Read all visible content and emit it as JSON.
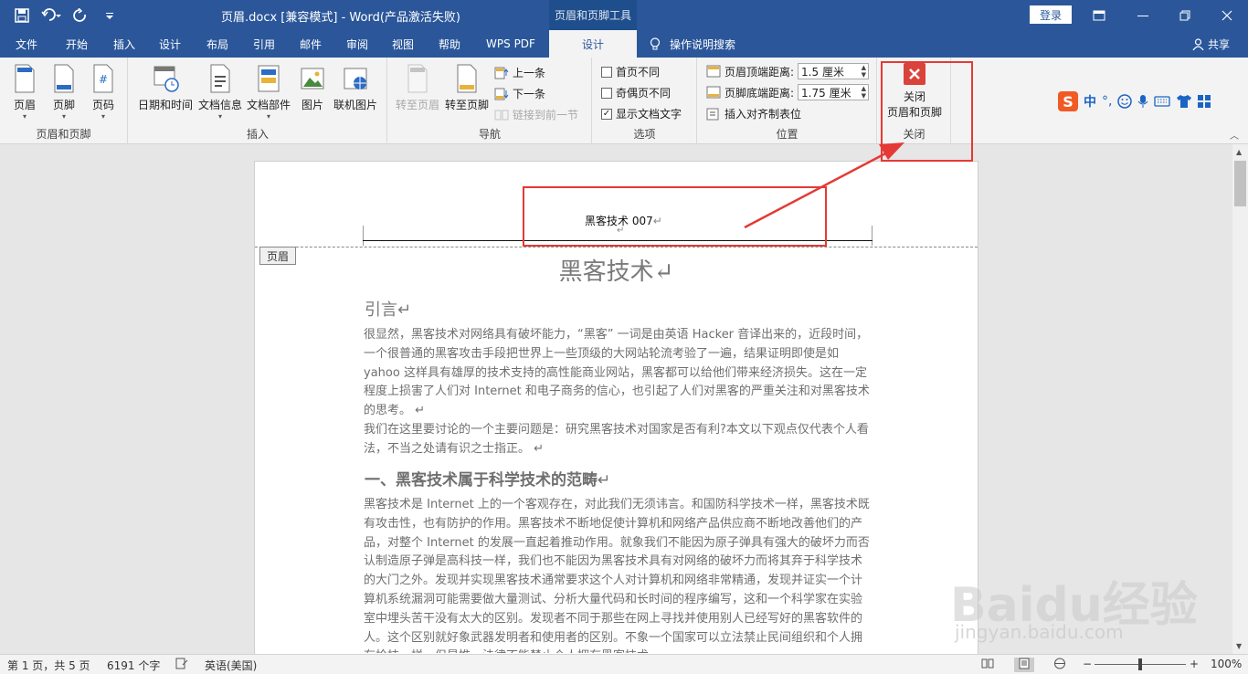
{
  "titlebar": {
    "title": "页眉.docx [兼容模式]  -  Word(产品激活失败)",
    "context_tool": "页眉和页脚工具",
    "login": "登录"
  },
  "tabs": [
    "文件",
    "开始",
    "插入",
    "设计",
    "布局",
    "引用",
    "邮件",
    "审阅",
    "视图",
    "帮助",
    "WPS PDF",
    "设计"
  ],
  "active_tab_index": 11,
  "search_label": "操作说明搜索",
  "share_label": "共享",
  "ribbon": {
    "group_header_footer": {
      "label": "页眉和页脚",
      "buttons": [
        "页眉",
        "页脚",
        "页码"
      ]
    },
    "group_insert": {
      "label": "插入",
      "buttons": [
        "日期和时间",
        "文档信息",
        "文档部件",
        "图片",
        "联机图片"
      ]
    },
    "group_nav": {
      "label": "导航",
      "goto_header": "转至页眉",
      "goto_footer": "转至页脚",
      "prev": "上一条",
      "next": "下一条",
      "link_prev": "链接到前一节"
    },
    "group_options": {
      "label": "选项",
      "diff_first": "首页不同",
      "diff_odd_even": "奇偶页不同",
      "show_doc_text": "显示文档文字",
      "show_doc_text_checked": true
    },
    "group_position": {
      "label": "位置",
      "header_top_label": "页眉顶端距离:",
      "header_top_value": "1.5 厘米",
      "footer_bottom_label": "页脚底端距离:",
      "footer_bottom_value": "1.75 厘米",
      "align_tab": "插入对齐制表位"
    },
    "group_close": {
      "label": "关闭",
      "button_line1": "关闭",
      "button_line2": "页眉和页脚"
    }
  },
  "ime_bar": [
    "中",
    "°,"
  ],
  "document": {
    "header_text": "黑客技术 007",
    "header_tag": "页眉",
    "title": "黑客技术",
    "intro_heading": "引言",
    "para1": "很显然，黑客技术对网络具有破坏能力，“黑客” 一词是由英语 Hacker 音译出来的，近段时间，一个很普通的黑客攻击手段把世界上一些顶级的大网站轮流考验了一遍，结果证明即使是如 yahoo 这样具有雄厚的技术支持的高性能商业网站，黑客都可以给他们带来经济损失。这在一定程度上损害了人们对 Internet 和电子商务的信心，也引起了人们对黑客的严重关注和对黑客技术的思考。",
    "para2": "我们在这里要讨论的一个主要问题是：研究黑客技术对国家是否有利?本文以下观点仅代表个人看法，不当之处请有识之士指正。",
    "heading1": "一、黑客技术属于科学技术的范畴",
    "para3": "黑客技术是 Internet 上的一个客观存在，对此我们无须讳言。和国防科学技术一样，黑客技术既有攻击性，也有防护的作用。黑客技术不断地促使计算机和网络产品供应商不断地改善他们的产品，对整个 Internet 的发展一直起着推动作用。就象我们不能因为原子弹具有强大的破坏力而否认制造原子弹是高科技一样，我们也不能因为黑客技术具有对网络的破坏力而将其弃于科学技术的大门之外。发现并实现黑客技术通常要求这个人对计算机和网络非常精通，发现并证实一个计算机系统漏洞可能需要做大量测试、分析大量代码和长时间的程序编写，这和一个科学家在实验室中埋头苦干没有太大的区别。发现者不同于那些在网上寻找并使用别人已经写好的黑客软件的人。这个区别就好象武器发明者和使用者的区别。不象一个国家可以立法禁止民间组织和个人拥有枪枝一样，但是惟一法律不能禁止个人拥有黑客技术"
  },
  "statusbar": {
    "page": "第 1 页，共 5 页",
    "words": "6191 个字",
    "language": "英语(美国)",
    "zoom": "100%"
  },
  "watermark": {
    "logo": "Baidu经验",
    "url": "jingyan.baidu.com"
  }
}
